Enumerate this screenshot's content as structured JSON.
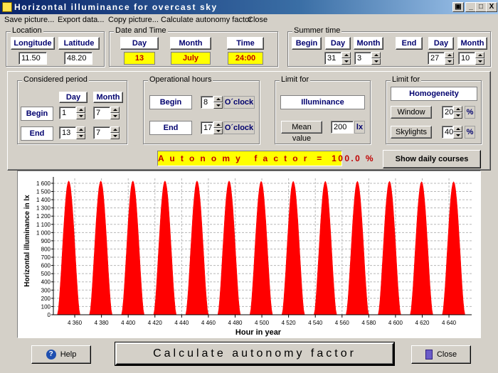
{
  "window": {
    "title": "Horizontal illuminance for overcast sky",
    "controls": {
      "tool": "▣",
      "minimize": "_",
      "maximize": "□",
      "close": "X"
    }
  },
  "menu": [
    "Save picture...",
    "Export data...",
    "Copy picture...",
    "Calculate autonomy factor",
    "Close"
  ],
  "location": {
    "label": "Location",
    "longitude_label": "Longitude",
    "latitude_label": "Latitude",
    "longitude": "11.50",
    "latitude": "48.20"
  },
  "datetime": {
    "label": "Date and Time",
    "day_label": "Day",
    "month_label": "Month",
    "time_label": "Time",
    "day": "13",
    "month": "July",
    "time": "24:00"
  },
  "summer_time": {
    "label": "Summer time",
    "begin_label": "Begin",
    "end_label": "End",
    "day_label": "Day",
    "month_label": "Month",
    "begin_day": "31",
    "begin_month": "3",
    "end_day": "27",
    "end_month": "10"
  },
  "period": {
    "label": "Considered period",
    "day_label": "Day",
    "month_label": "Month",
    "begin_label": "Begin",
    "end_label": "End",
    "begin_day": "1",
    "begin_month": "7",
    "end_day": "13",
    "end_month": "7"
  },
  "hours": {
    "label": "Operational hours",
    "begin_label": "Begin",
    "end_label": "End",
    "begin": "8",
    "end": "17",
    "unit": "O´clock"
  },
  "limit_illum": {
    "label": "Limit for",
    "button": "Illuminance",
    "mean_label": "Mean value",
    "mean_value": "200",
    "unit": "lx"
  },
  "limit_homog": {
    "label": "Limit for",
    "button": "Homogeneity",
    "window_label": "Window",
    "window_value": "20",
    "skylights_label": "Skylights",
    "skylights_value": "40",
    "unit": "%"
  },
  "autonomy_text": "A u t o n o m y   f a c t o r  =  100.0 %",
  "show_daily": "Show daily courses",
  "chart_data": {
    "type": "area",
    "xlabel": "Hour in year",
    "ylabel": "Horizontal illuminance in lx",
    "xlim": [
      4344,
      4657
    ],
    "ylim": [
      0,
      1660
    ],
    "xticks": [
      4360,
      4380,
      4400,
      4420,
      4440,
      4460,
      4480,
      4500,
      4520,
      4540,
      4560,
      4580,
      4600,
      4620,
      4640
    ],
    "xtick_labels": [
      "4 360",
      "4 380",
      "4 400",
      "4 420",
      "4 440",
      "4 460",
      "4 480",
      "4 500",
      "4 520",
      "4 540",
      "4 560",
      "4 580",
      "4 600",
      "4 620",
      "4 640"
    ],
    "yticks": [
      0,
      100,
      200,
      300,
      400,
      500,
      600,
      700,
      800,
      900,
      1000,
      1100,
      1200,
      1300,
      1400,
      1500,
      1600
    ],
    "ytick_labels": [
      "0",
      "100",
      "200",
      "300",
      "400",
      "500",
      "600",
      "700",
      "800",
      "900",
      "1 000",
      "1 100",
      "1 200",
      "1 300",
      "1 400",
      "1 500",
      "1 600"
    ],
    "series_color": "#ff0000",
    "grid": true,
    "days": [
      {
        "start": 4347,
        "end": 4364,
        "peak": 1630
      },
      {
        "start": 4371,
        "end": 4388,
        "peak": 1630
      },
      {
        "start": 4395,
        "end": 4412,
        "peak": 1630
      },
      {
        "start": 4419,
        "end": 4436,
        "peak": 1630
      },
      {
        "start": 4443,
        "end": 4460,
        "peak": 1630
      },
      {
        "start": 4467,
        "end": 4484,
        "peak": 1630
      },
      {
        "start": 4491,
        "end": 4508,
        "peak": 1625
      },
      {
        "start": 4515,
        "end": 4532,
        "peak": 1625
      },
      {
        "start": 4539,
        "end": 4556,
        "peak": 1625
      },
      {
        "start": 4563,
        "end": 4580,
        "peak": 1625
      },
      {
        "start": 4587,
        "end": 4604,
        "peak": 1625
      },
      {
        "start": 4611,
        "end": 4628,
        "peak": 1620
      },
      {
        "start": 4635,
        "end": 4652,
        "peak": 1620
      }
    ]
  },
  "footer": {
    "help": "Help",
    "calculate": "Calculate autonomy factor",
    "close": "Close"
  }
}
